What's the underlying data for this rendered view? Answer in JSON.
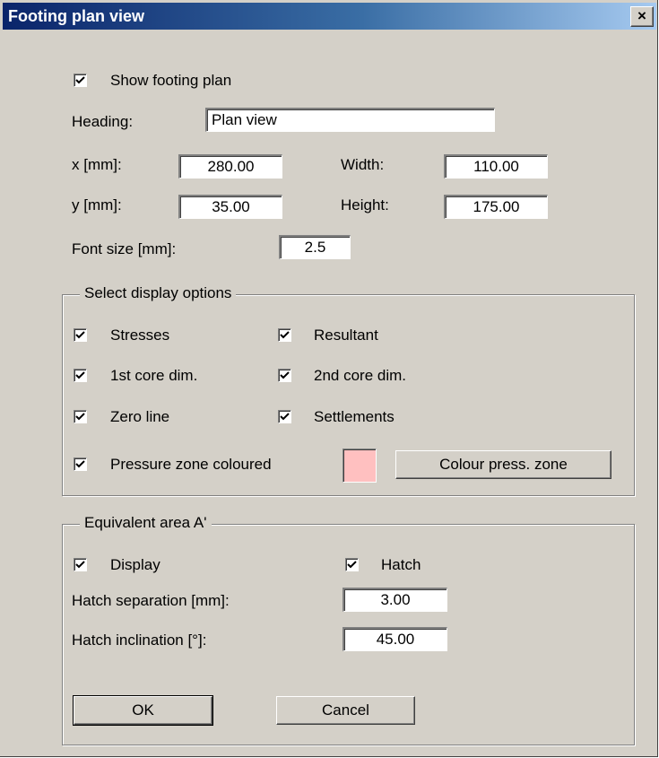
{
  "window": {
    "title": "Footing plan view",
    "close_symbol": "×"
  },
  "show_footing_plan": {
    "label": "Show footing plan",
    "checked": true
  },
  "heading": {
    "label": "Heading:",
    "value": "Plan view"
  },
  "x": {
    "label": "x [mm]:",
    "value": "280.00"
  },
  "y": {
    "label": "y [mm]:",
    "value": "35.00"
  },
  "width": {
    "label": "Width:",
    "value": "110.00"
  },
  "height": {
    "label": "Height:",
    "value": "175.00"
  },
  "font_size": {
    "label": "Font size [mm]:",
    "value": "2.5"
  },
  "display_options": {
    "title": "Select display options",
    "stresses": {
      "label": "Stresses",
      "checked": true
    },
    "resultant": {
      "label": "Resultant",
      "checked": true
    },
    "core1": {
      "label": "1st core dim.",
      "checked": true
    },
    "core2": {
      "label": "2nd core dim.",
      "checked": true
    },
    "zero_line": {
      "label": "Zero line",
      "checked": true
    },
    "settlements": {
      "label": "Settlements",
      "checked": true
    },
    "pressure_zone": {
      "label": "Pressure zone coloured",
      "checked": true
    },
    "pressure_zone_color": "#ffc0c0",
    "colour_button": "Colour press. zone"
  },
  "equivalent_area": {
    "title": "Equivalent area A'",
    "display": {
      "label": "Display",
      "checked": true
    },
    "hatch": {
      "label": "Hatch",
      "checked": true
    },
    "hatch_separation": {
      "label": "Hatch separation [mm]:",
      "value": "3.00"
    },
    "hatch_inclination": {
      "label": "Hatch inclination [°]:",
      "value": "45.00"
    }
  },
  "buttons": {
    "ok": "OK",
    "cancel": "Cancel"
  }
}
